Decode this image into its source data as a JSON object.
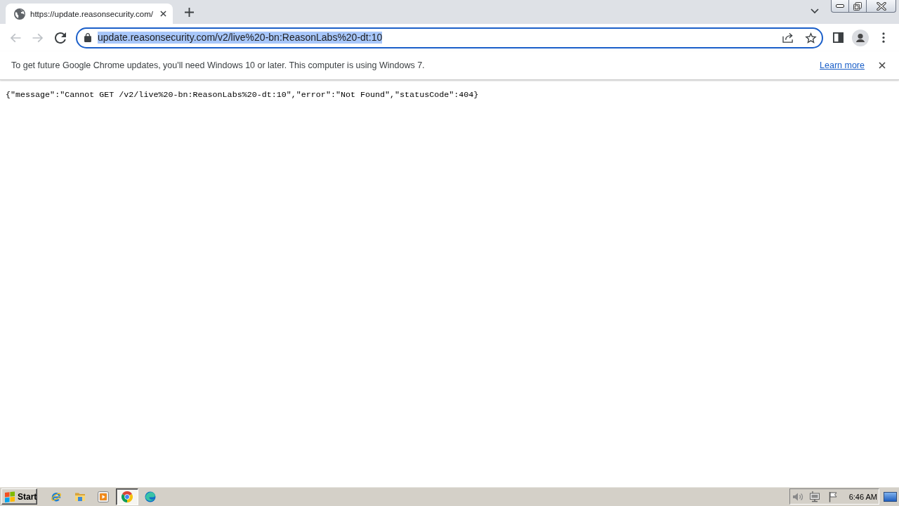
{
  "tabs": [
    {
      "title": "https://update.reasonsecurity.com/",
      "selected": true
    }
  ],
  "toolbar": {
    "back_disabled": true,
    "forward_disabled": true,
    "url": "update.reasonsecurity.com/v2/live%20-bn:ReasonLabs%20-dt:10",
    "url_selected": true
  },
  "infobar": {
    "message": "To get future Google Chrome updates, you'll need Windows 10 or later. This computer is using Windows 7.",
    "link": "Learn more"
  },
  "page": {
    "body": "{\"message\":\"Cannot GET /v2/live%20-bn:ReasonLabs%20-dt:10\",\"error\":\"Not Found\",\"statusCode\":404}"
  },
  "taskbar": {
    "start": "Start",
    "apps": [
      {
        "kind": "ie",
        "active": false
      },
      {
        "kind": "explorer",
        "active": false
      },
      {
        "kind": "media",
        "active": false
      },
      {
        "kind": "chrome",
        "active": true
      },
      {
        "kind": "edge",
        "active": false
      }
    ],
    "clock": "6:46 AM"
  }
}
